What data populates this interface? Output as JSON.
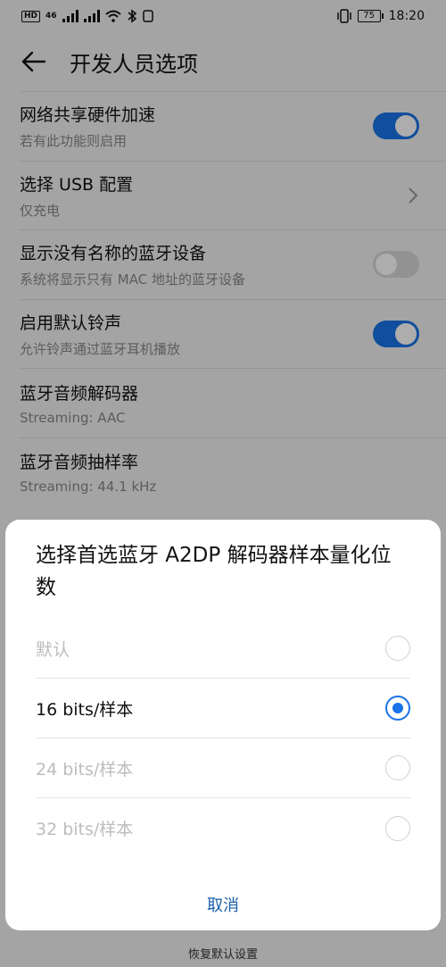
{
  "status_bar": {
    "hd_badge": "HD",
    "network": "46",
    "battery": "75",
    "time": "18:20"
  },
  "header": {
    "back_icon": "arrow-left-icon",
    "title": "开发人员选项"
  },
  "settings": [
    {
      "title": "网络共享硬件加速",
      "subtitle": "若有此功能则启用",
      "control": "toggle",
      "state": "on"
    },
    {
      "title": "选择 USB 配置",
      "subtitle": "仅充电",
      "control": "chevron"
    },
    {
      "title": "显示没有名称的蓝牙设备",
      "subtitle": "系统将显示只有 MAC 地址的蓝牙设备",
      "control": "toggle",
      "state": "off"
    },
    {
      "title": "启用默认铃声",
      "subtitle": "允许铃声通过蓝牙耳机播放",
      "control": "toggle",
      "state": "on"
    },
    {
      "title": "蓝牙音频解码器",
      "subtitle": "Streaming: AAC",
      "control": "none"
    },
    {
      "title": "蓝牙音频抽样率",
      "subtitle": "Streaming: 44.1 kHz",
      "control": "none"
    }
  ],
  "reset_label": "恢复默认设置",
  "dialog": {
    "title": "选择首选蓝牙 A2DP 解码器样本量化位数",
    "options": [
      {
        "label": "默认",
        "selected": false,
        "disabled": true
      },
      {
        "label": "16 bits/样本",
        "selected": true,
        "disabled": false
      },
      {
        "label": "24 bits/样本",
        "selected": false,
        "disabled": true
      },
      {
        "label": "32 bits/样本",
        "selected": false,
        "disabled": true
      }
    ],
    "cancel_label": "取消"
  },
  "colors": {
    "accent": "#1a73e8",
    "cancel_text": "#1a5fa8"
  }
}
